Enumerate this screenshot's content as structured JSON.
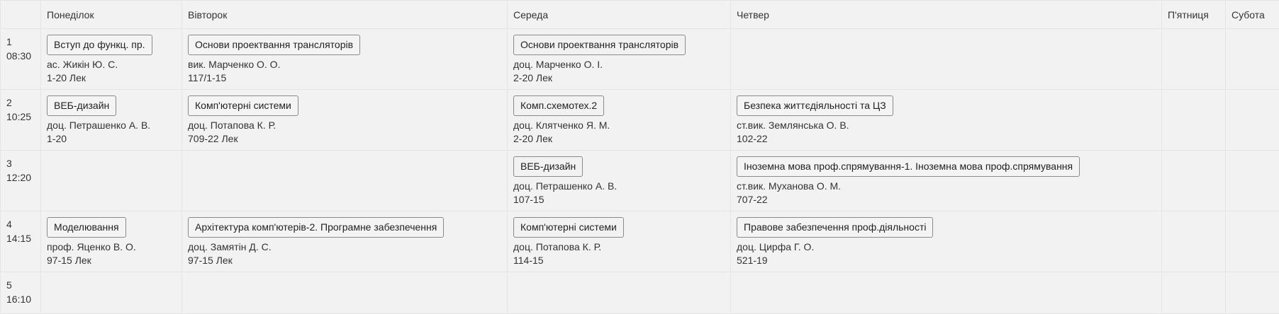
{
  "header": {
    "corner": "",
    "days": [
      "Понеділок",
      "Вівторок",
      "Середа",
      "Четвер",
      "П'ятниця",
      "Субота"
    ]
  },
  "rows": [
    {
      "num": "1",
      "time": "08:30",
      "cells": [
        {
          "subject": "Вступ до функц. пр.",
          "teacher": "ас. Жикін Ю. С.",
          "room": "1-20 Лек",
          "highlight": "none"
        },
        {
          "subject": "Основи проектвання трансляторів",
          "teacher": "вик. Марченко О. О.",
          "room": "117/1-15",
          "highlight": "none"
        },
        {
          "subject": "Основи проектвання трансляторів",
          "teacher": "доц. Марченко О. І.",
          "room": "2-20 Лек",
          "highlight": "cyan"
        },
        null,
        null,
        null
      ]
    },
    {
      "num": "2",
      "time": "10:25",
      "cells": [
        {
          "subject": "ВЕБ-дизайн",
          "teacher": "доц. Петрашенко А. В.",
          "room": "1-20",
          "highlight": "none"
        },
        {
          "subject": "Комп'ютерні системи",
          "teacher": "доц. Потапова К. Р.",
          "room": "709-22 Лек",
          "highlight": "none"
        },
        {
          "subject": "Комп.схемотех.2",
          "teacher": "доц. Клятченко Я. М.",
          "room": "2-20 Лек",
          "highlight": "green"
        },
        {
          "subject": "Безпека життєдіяльності та ЦЗ",
          "teacher": "ст.вик. Землянська О. В.",
          "room": "102-22",
          "highlight": "none"
        },
        null,
        null
      ]
    },
    {
      "num": "3",
      "time": "12:20",
      "cells": [
        null,
        null,
        {
          "subject": "ВЕБ-дизайн",
          "teacher": "доц. Петрашенко А. В.",
          "room": "107-15",
          "highlight": "cyan"
        },
        {
          "subject": "Іноземна мова проф.спрямування-1. Іноземна мова проф.спрямування",
          "teacher": "ст.вик. Муханова О. М.",
          "room": "707-22",
          "highlight": "none"
        },
        null,
        null
      ]
    },
    {
      "num": "4",
      "time": "14:15",
      "cells": [
        {
          "subject": "Моделювання",
          "teacher": "проф. Яценко В. О.",
          "room": "97-15 Лек",
          "highlight": "none"
        },
        {
          "subject": "Архітектура комп'ютерів-2. Програмне забезпечення",
          "teacher": "доц. Замятін Д. С.",
          "room": "97-15 Лек",
          "highlight": "none"
        },
        {
          "subject": "Комп'ютерні системи",
          "teacher": "доц. Потапова К. Р.",
          "room": "114-15",
          "highlight": "cyan"
        },
        {
          "subject": "Правове забезпечення проф.діяльності",
          "teacher": "доц. Цирфа Г. О.",
          "room": "521-19",
          "highlight": "none"
        },
        null,
        null
      ]
    },
    {
      "num": "5",
      "time": "16:10",
      "cells": [
        null,
        null,
        {
          "subject": null,
          "teacher": null,
          "room": null,
          "highlight": "cyan"
        },
        null,
        null,
        null
      ]
    }
  ],
  "colors": {
    "today_column": "#ace2df",
    "current_lesson": "#aed751",
    "grid_background": "#f2f2f2"
  }
}
